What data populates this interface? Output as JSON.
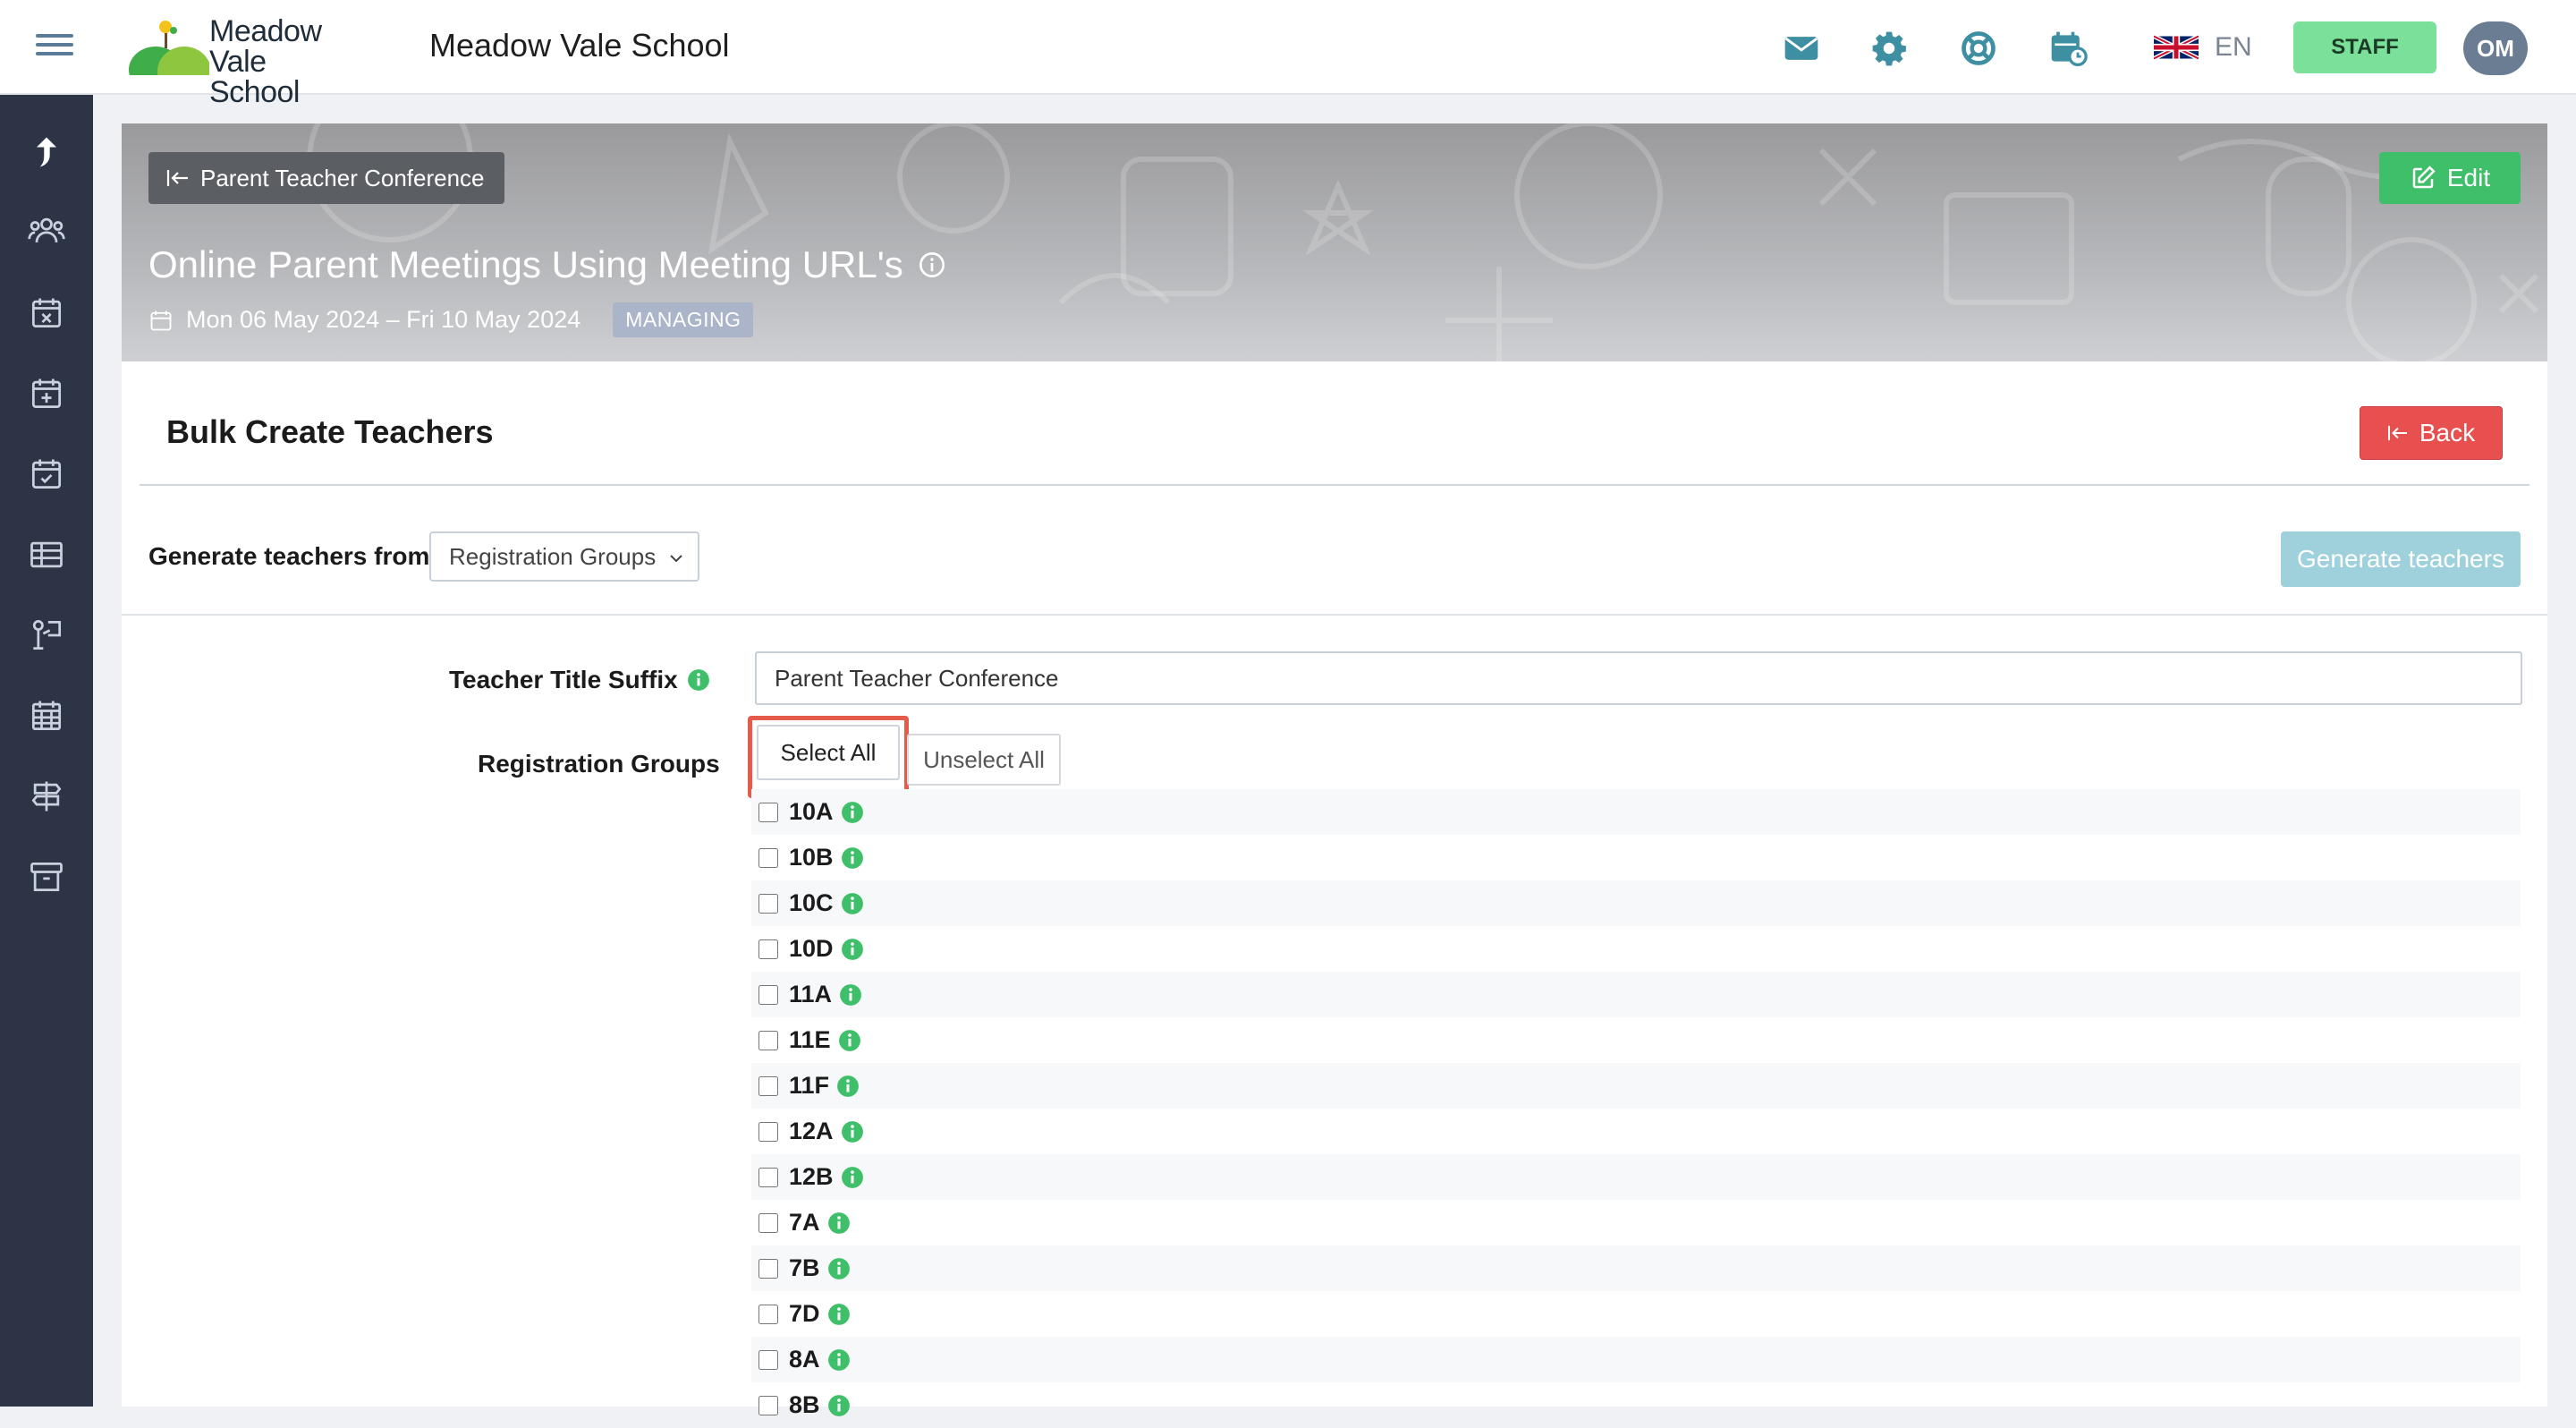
{
  "header": {
    "logo_text_line1": "Meadow",
    "logo_text_line2": "Vale School",
    "school_name": "Meadow Vale School",
    "language": "EN",
    "staff_label": "STAFF",
    "avatar_initials": "OM"
  },
  "banner": {
    "back_label": "Parent Teacher Conference",
    "edit_label": "Edit",
    "event_title": "Online Parent Meetings Using Meeting URL's",
    "event_dates": "Mon 06 May 2024 – Fri 10 May 2024",
    "status_badge": "MANAGING"
  },
  "page": {
    "section_title": "Bulk Create Teachers",
    "back_label": "Back",
    "generate_from_label": "Generate teachers from:",
    "generate_from_value": "Registration Groups",
    "generate_button": "Generate teachers",
    "suffix_label": "Teacher Title Suffix",
    "suffix_value": "Parent Teacher Conference",
    "groups_label": "Registration Groups",
    "select_all": "Select All",
    "unselect_all": "Unselect All"
  },
  "groups": [
    "10A",
    "10B",
    "10C",
    "10D",
    "11A",
    "11E",
    "11F",
    "12A",
    "12B",
    "7A",
    "7B",
    "7D",
    "8A",
    "8B"
  ],
  "colors": {
    "staff": "#7be09a",
    "edit": "#3fbf6a",
    "back": "#e8504f",
    "generate": "#9fd1dc",
    "highlight": "#e65a4a",
    "sidebar": "#2c3446",
    "icon_teal": "#3f8fa3",
    "info_green": "#3fbf6a"
  }
}
